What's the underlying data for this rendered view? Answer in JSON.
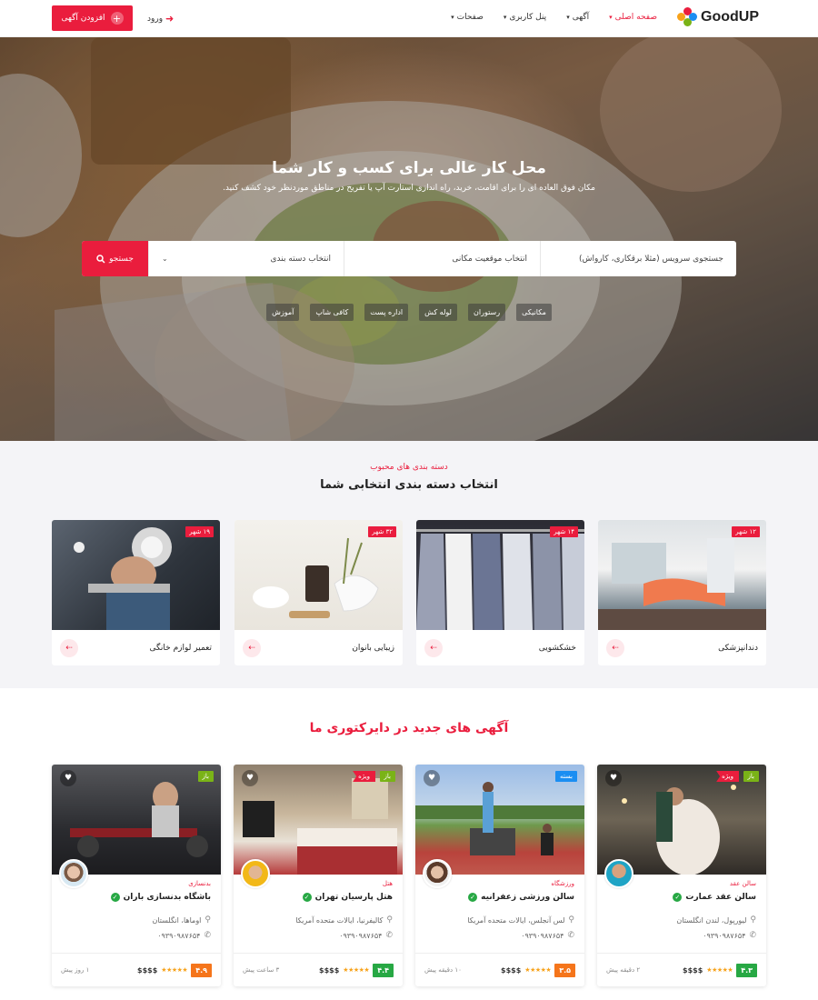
{
  "header": {
    "add_listing": "افزودن آگهی",
    "login": "ورود",
    "logo_text": "GoodUP",
    "nav": [
      {
        "label": "صفحه اصلی",
        "active": true
      },
      {
        "label": "آگهی",
        "active": false
      },
      {
        "label": "پنل کاربری",
        "active": false
      },
      {
        "label": "صفحات",
        "active": false
      }
    ]
  },
  "hero": {
    "title": "محل کار عالی برای کسب و کار شما",
    "subtitle": "مکان فوق العاده ای را برای اقامت، خرید، راه اندازی استارت آپ یا تفریح در مناطق موردنظر خود کشف کنید.",
    "search_placeholder": "جستجوی سرویس (مثلا برقکاری، کارواش)",
    "location_placeholder": "انتخاب موقعیت مکانی",
    "category_placeholder": "انتخاب دسته بندی",
    "search_button": "جستجو",
    "tags": [
      "مکانیکی",
      "رستوران",
      "لوله کش",
      "اداره پست",
      "کافی شاپ",
      "آموزش"
    ]
  },
  "categories": {
    "pretitle": "دسته بندی های محبوب",
    "title": "انتخاب دسته بندی انتخابی شما",
    "items": [
      {
        "name": "دندانپزشکی",
        "badge": "۱۲ شهر"
      },
      {
        "name": "خشکشویی",
        "badge": "۱۴ شهر"
      },
      {
        "name": "زیبایی بانوان",
        "badge": "۳۲ شهر"
      },
      {
        "name": "تعمیر لوازم خانگی",
        "badge": "۱۹ شهر"
      }
    ]
  },
  "listings": {
    "title": "آگهی های جدید در دایرکتوری ما",
    "items": [
      {
        "status": "باز",
        "status_color": "#7ab317",
        "featured": "ویژه",
        "category": "سالن عقد",
        "name": "سالن عقد عمارت",
        "location": "لیورپول، لندن انگلستان",
        "phone": "۰۹۳۹۰۹۸۷۶۵۴",
        "time": "۲ دقیقه پیش",
        "price": "$$$$",
        "score": "۴.۳",
        "score_color": "#27a844"
      },
      {
        "status": "بسته",
        "status_color": "#1b8ef2",
        "featured": "",
        "category": "ورزشگاه",
        "name": "سالن ورزشی زعفرانیه",
        "location": "لس آنجلس، ایالات متحده آمریکا",
        "phone": "۰۹۳۹۰۹۸۷۶۵۴",
        "time": "۱۰ دقیقه پیش",
        "price": "$$$$",
        "score": "۳.۵",
        "score_color": "#f5751b"
      },
      {
        "status": "باز",
        "status_color": "#7ab317",
        "featured": "ویژه",
        "category": "هتل",
        "name": "هتل پارسیان تهران",
        "location": "کالیفرنیا، ایالات متحده آمریکا",
        "phone": "۰۹۳۹۰۹۸۷۶۵۴",
        "time": "۳ ساعت پیش",
        "price": "$$$$",
        "score": "۴.۴",
        "score_color": "#27a844"
      },
      {
        "status": "باز",
        "status_color": "#7ab317",
        "featured": "",
        "category": "بدنسازی",
        "name": "باشگاه بدنسازی باران",
        "location": "اوماها، انگلستان",
        "phone": "۰۹۳۹۰۹۸۷۶۵۴",
        "time": "۱ روز پیش",
        "price": "$$$$",
        "score": "۴.۹",
        "score_color": "#f5751b"
      }
    ]
  },
  "colors": {
    "accent": "#ea1d3d",
    "open": "#7ab317",
    "closed": "#1b8ef2",
    "green": "#27a844",
    "orange": "#f5751b"
  }
}
